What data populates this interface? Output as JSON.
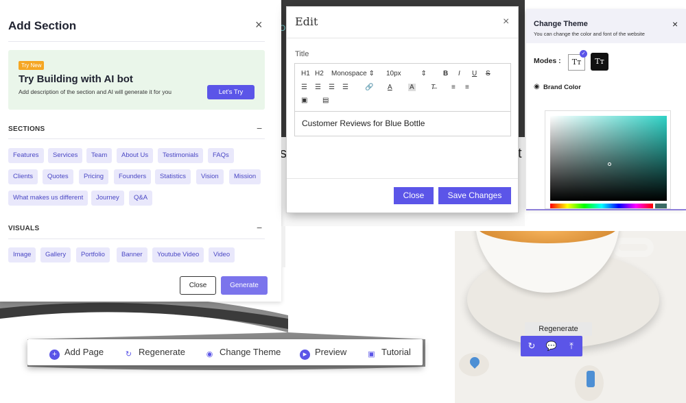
{
  "add_section": {
    "title": "Add Section",
    "close_glyph": "×",
    "ai_promo": {
      "badge": "Try New",
      "heading": "Try Building with AI bot",
      "description": "Add description of the section and AI will generate it for you",
      "cta": "Let's Try"
    },
    "sections": {
      "title": "SECTIONS",
      "collapse_glyph": "−",
      "chips": [
        "Features",
        "Services",
        "Team",
        "About Us",
        "Testimonials",
        "FAQs",
        "Clients",
        "Quotes",
        "Pricing",
        "Founders",
        "Statistics",
        "Vision",
        "Mission",
        "What makes us different",
        "Journey",
        "Q&A"
      ]
    },
    "visuals": {
      "title": "VISUALS",
      "collapse_glyph": "−",
      "chips": [
        "Image",
        "Gallery",
        "Portfolio",
        "Banner",
        "Youtube Video",
        "Video"
      ]
    },
    "close_label": "Close",
    "generate_label": "Generate"
  },
  "edit_modal": {
    "title": "Edit",
    "close_glyph": "×",
    "field_label": "Title",
    "toolbar": {
      "h1": "H1",
      "h2": "H2",
      "font": "Monospace",
      "size": "10px",
      "bold": "B",
      "italic": "I",
      "underline": "U",
      "strike": "S"
    },
    "content": "Customer Reviews for Blue Bottle",
    "close_label": "Close",
    "save_label": "Save Changes"
  },
  "change_theme": {
    "title": "Change Theme",
    "subtitle": "You can change the color and font of the website",
    "close_glyph": "×",
    "modes_label": "Modes :",
    "mode_glyph": "Tт",
    "brand_color_label": "Brand Color",
    "accent_color": "#2fd2c6"
  },
  "photo_actions": {
    "tooltip": "Regenerate"
  },
  "bottom_bar": {
    "add_page": "Add Page",
    "regenerate": "Regenerate",
    "change_theme": "Change Theme",
    "preview": "Preview",
    "tutorial": "Tutorial"
  },
  "colors": {
    "primary": "#5b55e8",
    "chip_bg": "#e9e8fb",
    "promo_bg": "#eaf6ea",
    "badge": "#f5a623"
  }
}
